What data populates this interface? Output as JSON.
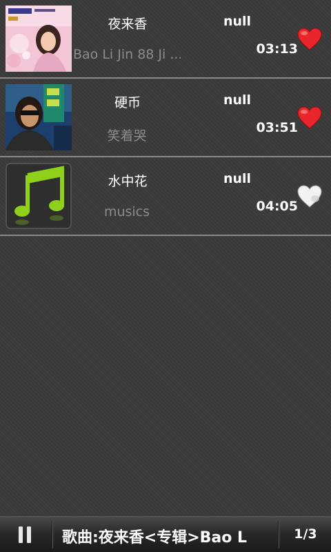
{
  "songs": [
    {
      "title": "夜来香",
      "artist": "null",
      "album": "Bao Li Jin 88 Ji ...",
      "duration": "03:13",
      "favorite": true,
      "cover": "album-art-teresa"
    },
    {
      "title": "硬币",
      "artist": "null",
      "album": "笑着哭",
      "duration": "03:51",
      "favorite": true,
      "cover": "album-art-singer"
    },
    {
      "title": "水中花",
      "artist": "null",
      "album": "musics",
      "duration": "04:05",
      "favorite": false,
      "cover": "music-note-icon"
    }
  ],
  "player": {
    "now_playing": "歌曲:夜来香<专辑>Bao L",
    "page_count": "1/3"
  },
  "colors": {
    "heart_favorite": "#e8262b",
    "heart_unfavorite": "#f2f2f2",
    "note_green": "#8fd11a",
    "album_text": "#8c8c8c"
  }
}
